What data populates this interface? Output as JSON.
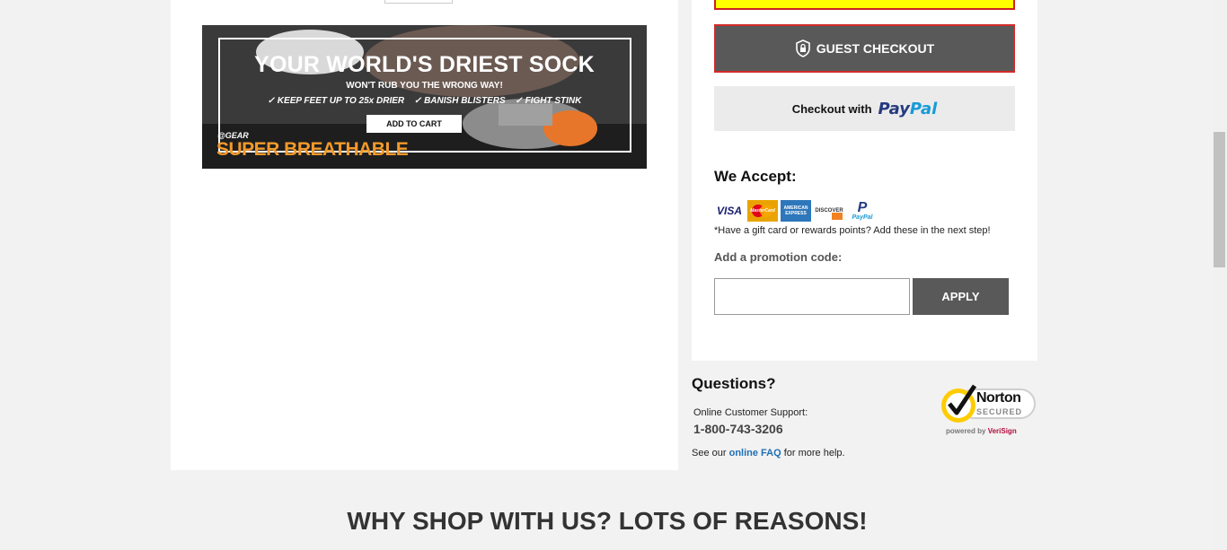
{
  "banner": {
    "headline": "YOUR WORLD'S DRIEST SOCK",
    "subline": "WON'T RUB YOU THE WRONG WAY!",
    "features": [
      "✓ KEEP FEET UP TO 25x DRIER",
      "✓ BANISH BLISTERS",
      "✓ FIGHT STINK"
    ],
    "cta": "ADD TO CART",
    "brand": "@GEAR",
    "tagline": "SUPER BREATHABLE"
  },
  "checkout": {
    "guest_label": "GUEST CHECKOUT",
    "paypal_prefix": "Checkout with",
    "paypal_word_a": "Pay",
    "paypal_word_b": "Pal"
  },
  "payment": {
    "title": "We Accept:",
    "cards": [
      "visa-icon",
      "mastercard-icon",
      "amex-icon",
      "discover-icon",
      "paypal-icon"
    ],
    "visa": "VISA",
    "mastercard": "MasterCard",
    "amex": "AMERICAN EXPRESS",
    "discover": "DISCOVER",
    "paypal": "PayPal",
    "gift_note": "*Have a gift card or rewards points? Add these in the next step!"
  },
  "promo": {
    "label": "Add a promotion code:",
    "value": "",
    "placeholder": "",
    "apply_label": "APPLY"
  },
  "help": {
    "title": "Questions?",
    "support_label": "Online Customer Support:",
    "phone": "1-800-743-3206",
    "faq_prefix": "See our",
    "faq_link": "online FAQ",
    "faq_suffix": "for more help."
  },
  "norton": {
    "name": "Norton",
    "secured": "SECURED",
    "powered_by": "powered by",
    "verisign": "VeriSign"
  },
  "reasons_heading": "WHY SHOP WITH US? LOTS OF REASONS!",
  "colors": {
    "accent_yellow": "#ffff00",
    "button_gray": "#595959",
    "button_border_red": "#d42a2a",
    "link_blue": "#1f6fb3",
    "banner_orange": "#f39a2b"
  }
}
